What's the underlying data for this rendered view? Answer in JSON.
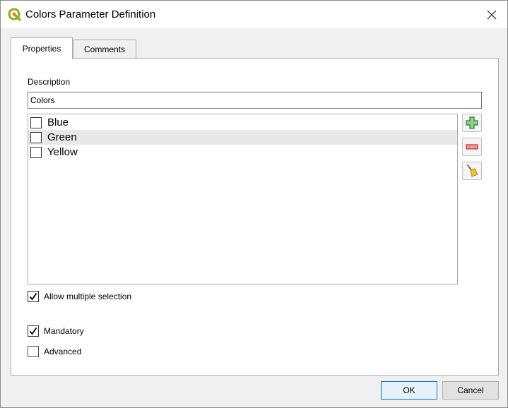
{
  "window": {
    "title": "Colors Parameter Definition"
  },
  "tabs": [
    {
      "label": "Properties",
      "active": true
    },
    {
      "label": "Comments",
      "active": false
    }
  ],
  "description": {
    "label": "Description",
    "value": "Colors"
  },
  "list": {
    "items": [
      {
        "label": "Blue",
        "checked": false
      },
      {
        "label": "Green",
        "checked": false
      },
      {
        "label": "Yellow",
        "checked": false
      }
    ]
  },
  "side_buttons": {
    "add_icon": "plus-icon",
    "remove_icon": "minus-icon",
    "clear_icon": "broom-icon"
  },
  "options": {
    "allow_multiple": {
      "label": "Allow multiple selection",
      "checked": true
    },
    "mandatory": {
      "label": "Mandatory",
      "checked": true
    },
    "advanced": {
      "label": "Advanced",
      "checked": false
    }
  },
  "buttons": {
    "ok": "OK",
    "cancel": "Cancel"
  },
  "colors": {
    "accent": "#0078d7",
    "add": "#3a9a3a",
    "remove": "#d9534f"
  }
}
